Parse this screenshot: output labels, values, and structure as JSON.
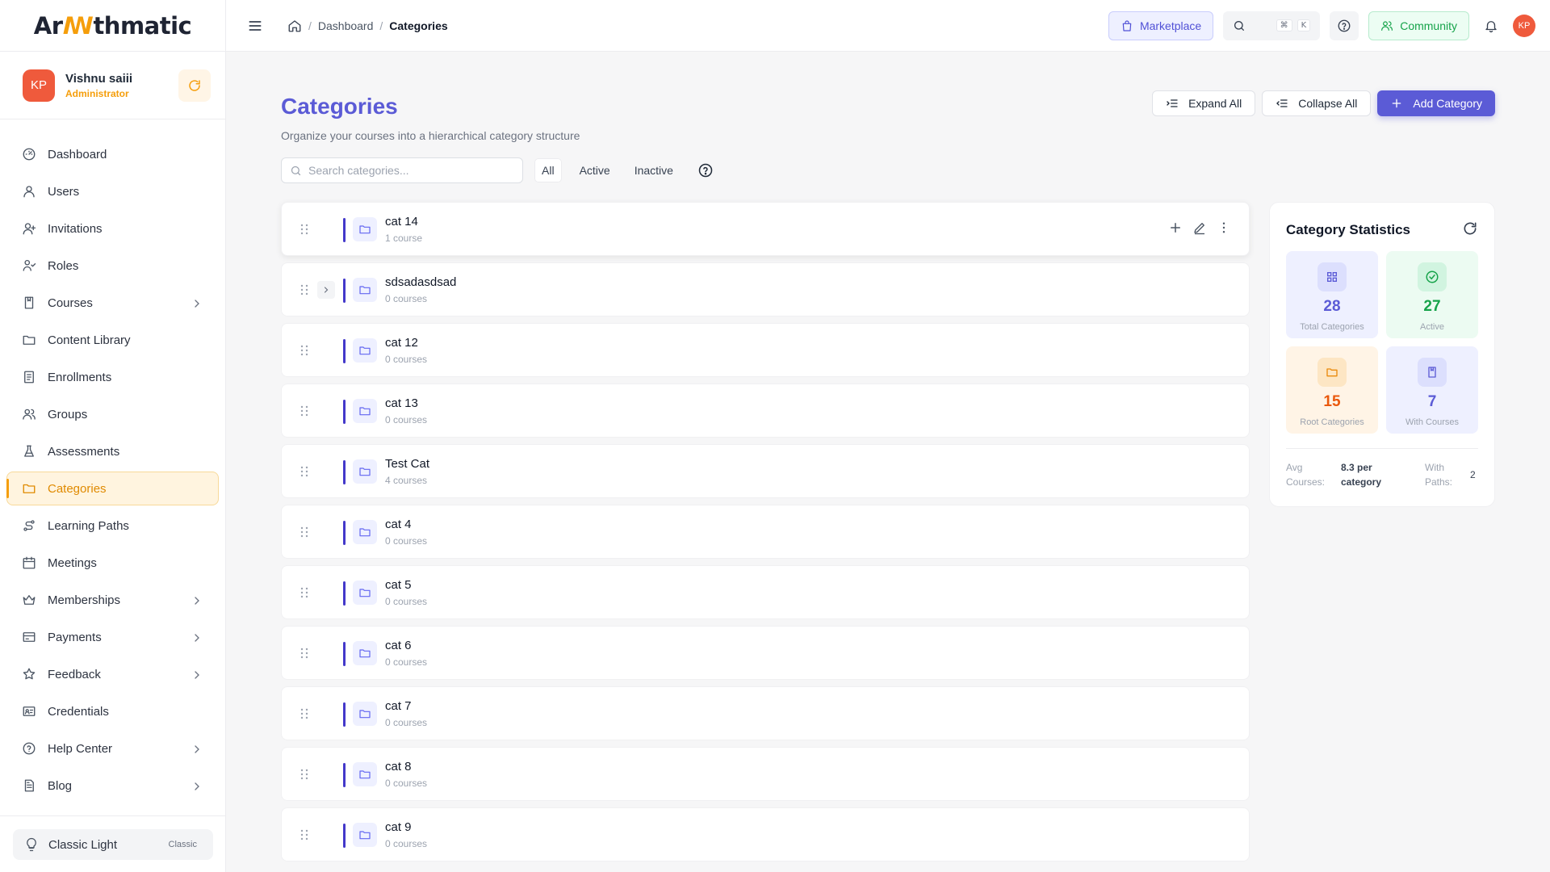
{
  "brand": {
    "logo_prefix": "Ar",
    "logo_accent": "ꟿ",
    "logo_suffix": "thmatic"
  },
  "user": {
    "initials": "KP",
    "name": "Vishnu saiii",
    "role": "Administrator"
  },
  "sidebar": {
    "items": [
      {
        "label": "Dashboard",
        "icon": "dashboard-icon",
        "chevron": false,
        "active": false
      },
      {
        "label": "Users",
        "icon": "user-icon",
        "chevron": false,
        "active": false
      },
      {
        "label": "Invitations",
        "icon": "invite-icon",
        "chevron": false,
        "active": false
      },
      {
        "label": "Roles",
        "icon": "roles-icon",
        "chevron": false,
        "active": false
      },
      {
        "label": "Courses",
        "icon": "book-icon",
        "chevron": true,
        "active": false
      },
      {
        "label": "Content Library",
        "icon": "folder-icon",
        "chevron": false,
        "active": false
      },
      {
        "label": "Enrollments",
        "icon": "clipboard-icon",
        "chevron": false,
        "active": false
      },
      {
        "label": "Groups",
        "icon": "groups-icon",
        "chevron": false,
        "active": false
      },
      {
        "label": "Assessments",
        "icon": "flask-icon",
        "chevron": false,
        "active": false
      },
      {
        "label": "Categories",
        "icon": "folder-icon",
        "chevron": false,
        "active": true
      },
      {
        "label": "Learning Paths",
        "icon": "route-icon",
        "chevron": false,
        "active": false
      },
      {
        "label": "Meetings",
        "icon": "calendar-icon",
        "chevron": false,
        "active": false
      },
      {
        "label": "Memberships",
        "icon": "crown-icon",
        "chevron": true,
        "active": false
      },
      {
        "label": "Payments",
        "icon": "card-icon",
        "chevron": true,
        "active": false
      },
      {
        "label": "Feedback",
        "icon": "star-icon",
        "chevron": true,
        "active": false
      },
      {
        "label": "Credentials",
        "icon": "id-card-icon",
        "chevron": false,
        "active": false
      },
      {
        "label": "Help Center",
        "icon": "help-icon",
        "chevron": true,
        "active": false
      },
      {
        "label": "Blog",
        "icon": "document-icon",
        "chevron": true,
        "active": false
      }
    ],
    "theme": {
      "label": "Classic Light",
      "tag": "Classic"
    }
  },
  "topbar": {
    "breadcrumb": [
      "Dashboard",
      "Categories"
    ],
    "marketplace": "Marketplace",
    "kbd_cmd": "⌘",
    "kbd_k": "K",
    "community": "Community",
    "avatar": "KP"
  },
  "page": {
    "title": "Categories",
    "subtitle": "Organize your courses into a hierarchical category structure",
    "expand_all": "Expand All",
    "collapse_all": "Collapse All",
    "add_category": "Add Category",
    "search_placeholder": "Search categories...",
    "filters": [
      "All",
      "Active",
      "Inactive"
    ]
  },
  "categories": [
    {
      "name": "cat 14",
      "count": "1 course",
      "expandable": false
    },
    {
      "name": "sdsadasdsad",
      "count": "0 courses",
      "expandable": true
    },
    {
      "name": "cat 12",
      "count": "0 courses",
      "expandable": false
    },
    {
      "name": "cat 13",
      "count": "0 courses",
      "expandable": false
    },
    {
      "name": "Test Cat",
      "count": "4 courses",
      "expandable": false
    },
    {
      "name": "cat 4",
      "count": "0 courses",
      "expandable": false
    },
    {
      "name": "cat 5",
      "count": "0 courses",
      "expandable": false
    },
    {
      "name": "cat 6",
      "count": "0 courses",
      "expandable": false
    },
    {
      "name": "cat 7",
      "count": "0 courses",
      "expandable": false
    },
    {
      "name": "cat 8",
      "count": "0 courses",
      "expandable": false
    },
    {
      "name": "cat 9",
      "count": "0 courses",
      "expandable": false
    }
  ],
  "stats": {
    "title": "Category Statistics",
    "tiles": [
      {
        "value": "28",
        "label": "Total Categories"
      },
      {
        "value": "27",
        "label": "Active"
      },
      {
        "value": "15",
        "label": "Root Categories"
      },
      {
        "value": "7",
        "label": "With Courses"
      }
    ],
    "avg_label_1": "Avg",
    "avg_label_2": "Courses:",
    "avg_value_1": "8.3 per",
    "avg_value_2": "category",
    "paths_label_1": "With",
    "paths_label_2": "Paths:",
    "paths_value": "2"
  }
}
